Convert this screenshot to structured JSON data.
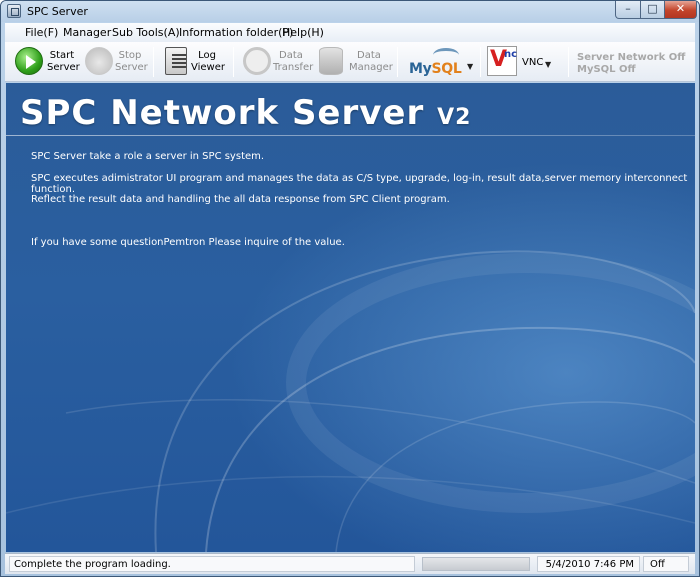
{
  "window": {
    "title": "SPC Server"
  },
  "menu": [
    "File(F)",
    "Manager",
    "Sub Tools(A)",
    "Information folder(P)",
    "Help(H)"
  ],
  "toolbar": {
    "start": [
      "Start",
      "Server"
    ],
    "stop": [
      "Stop",
      "Server"
    ],
    "log": [
      "Log",
      "Viewer"
    ],
    "transfer": [
      "Data",
      "Transfer"
    ],
    "manager": [
      "Data",
      "Manager"
    ],
    "mysql": {
      "brand_a": "My",
      "brand_b": "SQL"
    },
    "vnc": {
      "logo_v": "V",
      "logo_nc": "nc",
      "label": "VNC"
    },
    "status": {
      "network": "Server Network Off",
      "mysql": "MySQL Off"
    }
  },
  "main": {
    "banner": "SPC Network Server",
    "banner_version": "V2",
    "lines": [
      "SPC Server take a role a server in SPC system.",
      "SPC executes adimistrator UI program and manages the data as C/S type, upgrade, log-in, result data,server memory interconnect function.",
      "Reflect the result data and handling the all data response from SPC Client program.",
      "If you have some questionPemtron Please inquire of the value."
    ]
  },
  "statusbar": {
    "message": "Complete the program loading.",
    "datetime": "5/4/2010 7:46 PM",
    "state": "Off"
  }
}
